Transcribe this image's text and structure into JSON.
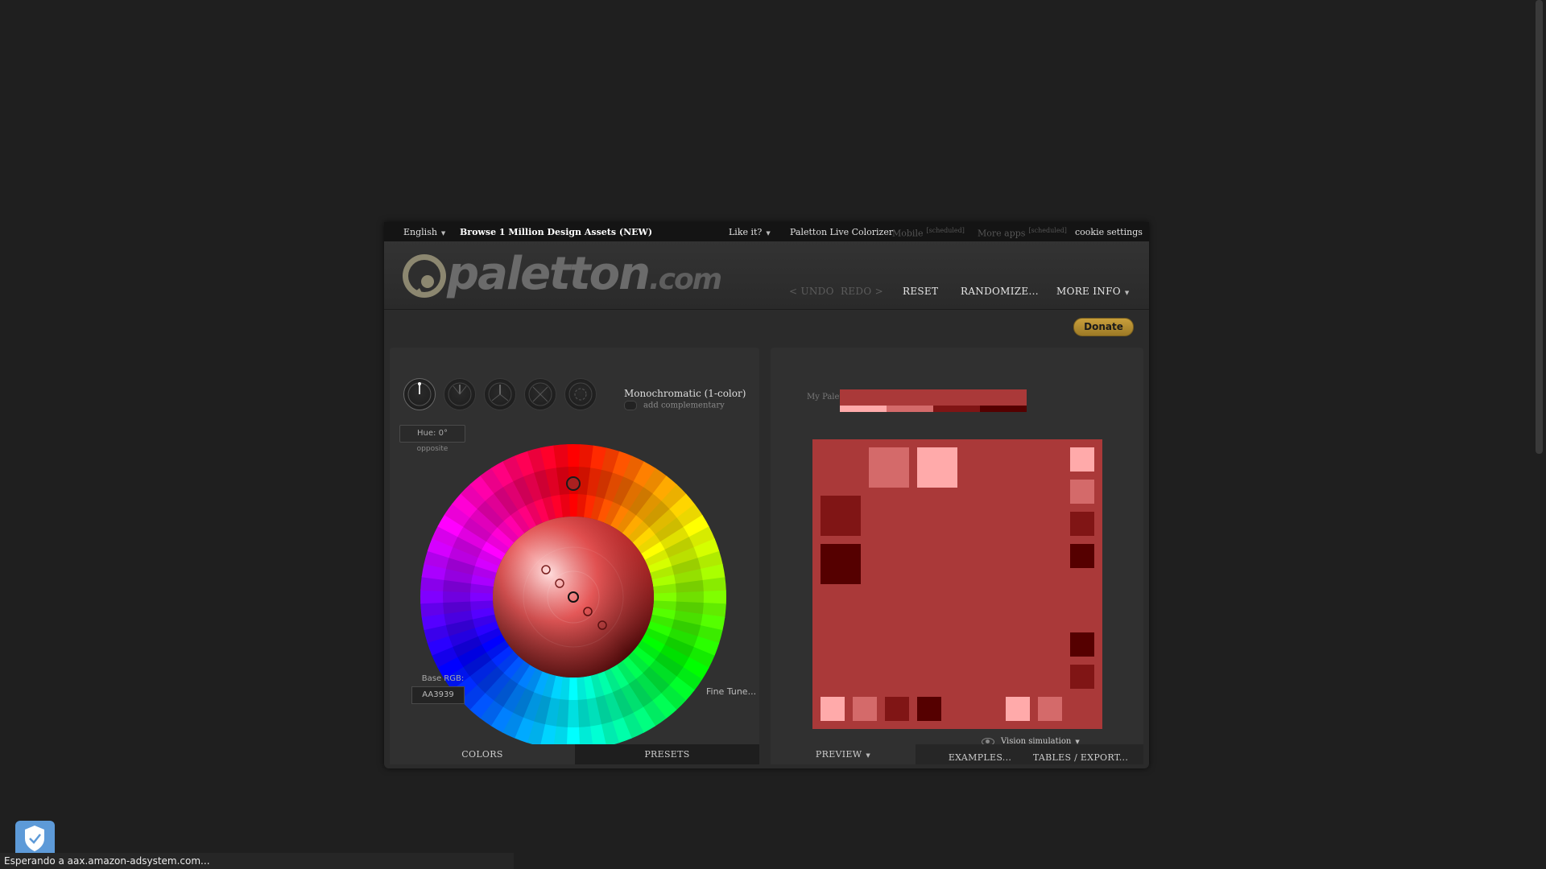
{
  "topbar": {
    "language": "English",
    "browse": "Browse 1 Million Design Assets (NEW)",
    "like": "Like it?",
    "live_colorizer": "Paletton Live Colorizer",
    "mobile": "Mobile",
    "mobile_tag": "[scheduled]",
    "more_apps": "More apps",
    "more_apps_tag": "[scheduled]",
    "cookie": "cookie settings"
  },
  "header": {
    "logo_main": "paletton",
    "logo_tld": ".com",
    "undo": "< UNDO",
    "redo": "REDO >",
    "reset": "RESET",
    "randomize": "RANDOMIZE...",
    "more_info": "MORE INFO"
  },
  "donate": "Donate",
  "left": {
    "scheme_title": "Monochromatic (1-color)",
    "add_complementary": "add complementary",
    "hue": "Hue: 0°",
    "opposite": "opposite",
    "base_rgb_label": "Base RGB:",
    "base_rgb_value": "AA3939",
    "fine_tune": "Fine Tune...",
    "tab_colors": "COLORS",
    "tab_presets": "PRESETS",
    "scheme_icons": [
      "mono-scheme-icon",
      "adjacent-scheme-icon",
      "triad-scheme-icon",
      "tetrad-scheme-icon",
      "free-style-scheme-icon"
    ]
  },
  "right": {
    "my_palette_label": "My Palette:",
    "vision": "Vision simulation",
    "tab_preview": "PREVIEW",
    "tab_examples": "EXAMPLES...",
    "tab_tables": "TABLES / EXPORT..."
  },
  "palette": {
    "base": "#AA3939",
    "lightest": "#FFAAAA",
    "light": "#D46A6A",
    "dark": "#801515",
    "darkest": "#550000"
  },
  "status": "Esperando a aax.amazon-adsystem.com..."
}
